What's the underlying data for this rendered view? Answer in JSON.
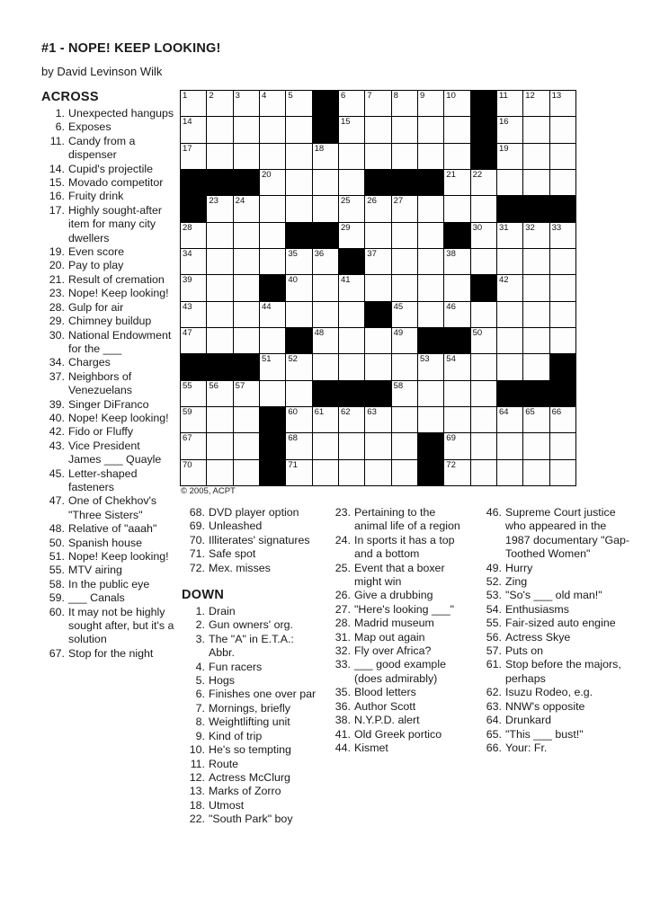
{
  "header": {
    "title": "#1 - NOPE! KEEP LOOKING!",
    "byline": "by David Levinson Wilk"
  },
  "grid": {
    "copyright": "© 2005, ACPT",
    "rows": 15,
    "cols": 15,
    "layout": [
      "OOOOO#OOOOO#OOO",
      "OOOOO#OOOOO#OOO",
      "OOOOOOOOOOO#OOO",
      "###OOOO###OOOOO",
      "#OOOOOOOOOOO###",
      "OOOO##OOOO#OOOO",
      "OOOOOO#OOOOOOOO",
      "OOO#OOOOOOO#OOO",
      "OOOOOOO#OOOOOOO",
      "OOOO#OOOO##OOOO",
      "###OOOOOOOOOOO#",
      "OOOOO###OOOO###",
      "OOO#OOOOOOOOOOO",
      "OOO#OOOOO#OOOOO",
      "OOO#OOOOO#OOOOO"
    ],
    "numbers": {
      "0,0": "1",
      "0,1": "2",
      "0,2": "3",
      "0,3": "4",
      "0,4": "5",
      "0,6": "6",
      "0,7": "7",
      "0,8": "8",
      "0,9": "9",
      "0,10": "10",
      "0,12": "11",
      "0,13": "12",
      "0,14": "13",
      "1,0": "14",
      "1,6": "15",
      "1,12": "16",
      "2,0": "17",
      "2,5": "18",
      "2,12": "19",
      "3,3": "20",
      "3,10": "21",
      "3,11": "22",
      "4,1": "23",
      "4,2": "24",
      "4,6": "25",
      "4,7": "26",
      "4,8": "27",
      "5,0": "28",
      "5,6": "29",
      "5,11": "30",
      "5,12": "31",
      "5,13": "32",
      "5,14": "33",
      "6,0": "34",
      "6,4": "35",
      "6,5": "36",
      "6,7": "37",
      "6,10": "38",
      "7,0": "39",
      "7,4": "40",
      "7,6": "41",
      "7,12": "42",
      "8,0": "43",
      "8,3": "44",
      "8,8": "45",
      "8,10": "46",
      "9,0": "47",
      "9,5": "48",
      "9,8": "49",
      "9,11": "50",
      "10,3": "51",
      "10,4": "52",
      "10,9": "53",
      "10,10": "54",
      "11,0": "55",
      "11,1": "56",
      "11,2": "57",
      "11,8": "58",
      "12,0": "59",
      "12,4": "60",
      "12,5": "61",
      "12,6": "62",
      "12,7": "63",
      "12,12": "64",
      "12,13": "65",
      "12,14": "66",
      "13,0": "67",
      "13,4": "68",
      "13,10": "69",
      "14,0": "70",
      "14,4": "71",
      "14,10": "72"
    }
  },
  "across": {
    "heading": "ACROSS",
    "clues": [
      {
        "num": "1.",
        "text": "Unexpected hangups"
      },
      {
        "num": "6.",
        "text": "Exposes"
      },
      {
        "num": "11.",
        "text": "Candy from a dispenser"
      },
      {
        "num": "14.",
        "text": "Cupid's projectile"
      },
      {
        "num": "15.",
        "text": "Movado competitor"
      },
      {
        "num": "16.",
        "text": "Fruity drink"
      },
      {
        "num": "17.",
        "text": "Highly sought-after item for many city dwellers"
      },
      {
        "num": "19.",
        "text": "Even score"
      },
      {
        "num": "20.",
        "text": "Pay to play"
      },
      {
        "num": "21.",
        "text": "Result of cremation"
      },
      {
        "num": "23.",
        "text": "Nope! Keep looking!"
      },
      {
        "num": "28.",
        "text": "Gulp for air"
      },
      {
        "num": "29.",
        "text": "Chimney buildup"
      },
      {
        "num": "30.",
        "text": "National Endowment for the ___"
      },
      {
        "num": "34.",
        "text": "Charges"
      },
      {
        "num": "37.",
        "text": "Neighbors of Venezuelans"
      },
      {
        "num": "39.",
        "text": "Singer DiFranco"
      },
      {
        "num": "40.",
        "text": "Nope! Keep looking!"
      },
      {
        "num": "42.",
        "text": "Fido or Fluffy"
      },
      {
        "num": "43.",
        "text": "Vice President James ___ Quayle"
      },
      {
        "num": "45.",
        "text": "Letter-shaped fasteners"
      },
      {
        "num": "47.",
        "text": "One of Chekhov's \"Three Sisters\""
      },
      {
        "num": "48.",
        "text": "Relative of \"aaah\""
      },
      {
        "num": "50.",
        "text": "Spanish house"
      },
      {
        "num": "51.",
        "text": "Nope! Keep looking!"
      },
      {
        "num": "55.",
        "text": "MTV airing"
      },
      {
        "num": "58.",
        "text": "In the public eye"
      },
      {
        "num": "59.",
        "text": "___ Canals"
      },
      {
        "num": "60.",
        "text": "It may not be highly sought after, but it's a solution"
      },
      {
        "num": "67.",
        "text": "Stop for the night"
      }
    ],
    "clues_col2": [
      {
        "num": "68.",
        "text": "DVD player option"
      },
      {
        "num": "69.",
        "text": "Unleashed"
      },
      {
        "num": "70.",
        "text": "Illiterates' signatures"
      },
      {
        "num": "71.",
        "text": "Safe spot"
      },
      {
        "num": "72.",
        "text": "Mex. misses"
      }
    ]
  },
  "down": {
    "heading": "DOWN",
    "clues_col2": [
      {
        "num": "1.",
        "text": "Drain"
      },
      {
        "num": "2.",
        "text": "Gun owners' org."
      },
      {
        "num": "3.",
        "text": "The \"A\" in E.T.A.: Abbr."
      },
      {
        "num": "4.",
        "text": "Fun racers"
      },
      {
        "num": "5.",
        "text": "Hogs"
      },
      {
        "num": "6.",
        "text": "Finishes one over par"
      },
      {
        "num": "7.",
        "text": "Mornings, briefly"
      },
      {
        "num": "8.",
        "text": "Weightlifting unit"
      },
      {
        "num": "9.",
        "text": "Kind of trip"
      },
      {
        "num": "10.",
        "text": "He's so tempting"
      },
      {
        "num": "11.",
        "text": "Route"
      },
      {
        "num": "12.",
        "text": "Actress McClurg"
      },
      {
        "num": "13.",
        "text": "Marks of Zorro"
      },
      {
        "num": "18.",
        "text": "Utmost"
      },
      {
        "num": "22.",
        "text": "\"South Park\" boy"
      }
    ],
    "clues_col3": [
      {
        "num": "23.",
        "text": "Pertaining to the animal life of a region"
      },
      {
        "num": "24.",
        "text": "In sports it has a top and a bottom"
      },
      {
        "num": "25.",
        "text": "Event that a boxer might win"
      },
      {
        "num": "26.",
        "text": "Give a drubbing"
      },
      {
        "num": "27.",
        "text": "\"Here's looking ___\""
      },
      {
        "num": "28.",
        "text": "Madrid museum"
      },
      {
        "num": "31.",
        "text": "Map out again"
      },
      {
        "num": "32.",
        "text": "Fly over Africa?"
      },
      {
        "num": "33.",
        "text": "___ good example (does admirably)"
      },
      {
        "num": "35.",
        "text": "Blood letters"
      },
      {
        "num": "36.",
        "text": "Author Scott"
      },
      {
        "num": "38.",
        "text": "N.Y.P.D. alert"
      },
      {
        "num": "41.",
        "text": "Old Greek portico"
      },
      {
        "num": "44.",
        "text": "Kismet"
      }
    ],
    "clues_col4": [
      {
        "num": "46.",
        "text": "Supreme Court justice who appeared in the 1987 documentary \"Gap-Toothed Women\""
      },
      {
        "num": "49.",
        "text": "Hurry"
      },
      {
        "num": "52.",
        "text": "Zing"
      },
      {
        "num": "53.",
        "text": "\"So's ___ old man!\""
      },
      {
        "num": "54.",
        "text": "Enthusiasms"
      },
      {
        "num": "55.",
        "text": "Fair-sized auto engine"
      },
      {
        "num": "56.",
        "text": "Actress Skye"
      },
      {
        "num": "57.",
        "text": "Puts on"
      },
      {
        "num": "61.",
        "text": "Stop before the majors, perhaps"
      },
      {
        "num": "62.",
        "text": "Isuzu Rodeo, e.g."
      },
      {
        "num": "63.",
        "text": "NNW's opposite"
      },
      {
        "num": "64.",
        "text": "Drunkard"
      },
      {
        "num": "65.",
        "text": "\"This ___ bust!\""
      },
      {
        "num": "66.",
        "text": "Your: Fr."
      }
    ]
  }
}
